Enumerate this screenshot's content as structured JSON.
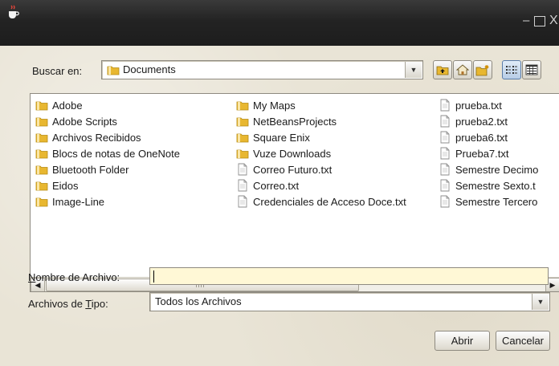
{
  "window": {
    "icon": "java-coffee-icon",
    "controls": {
      "minimize": "–",
      "close": "X"
    }
  },
  "lookin": {
    "label": "Buscar en:",
    "value": "Documents"
  },
  "toolbar": {
    "icons": [
      "up-folder-icon",
      "home-icon",
      "new-folder-icon",
      "list-view-icon",
      "details-view-icon"
    ]
  },
  "files": {
    "columns": [
      [
        {
          "name": "Adobe",
          "type": "folder"
        },
        {
          "name": "Adobe Scripts",
          "type": "folder"
        },
        {
          "name": "Archivos Recibidos",
          "type": "folder"
        },
        {
          "name": "Blocs de notas de OneNote",
          "type": "folder"
        },
        {
          "name": "Bluetooth Folder",
          "type": "folder"
        },
        {
          "name": "Eidos",
          "type": "folder"
        },
        {
          "name": "Image-Line",
          "type": "folder"
        }
      ],
      [
        {
          "name": "My Maps",
          "type": "folder"
        },
        {
          "name": "NetBeansProjects",
          "type": "folder"
        },
        {
          "name": "Square Enix",
          "type": "folder"
        },
        {
          "name": "Vuze Downloads",
          "type": "folder"
        },
        {
          "name": "Correo Futuro.txt",
          "type": "file"
        },
        {
          "name": "Correo.txt",
          "type": "file"
        },
        {
          "name": "Credenciales de Acceso Doce.txt",
          "type": "file"
        }
      ],
      [
        {
          "name": "prueba.txt",
          "type": "file"
        },
        {
          "name": "prueba2.txt",
          "type": "file"
        },
        {
          "name": "prueba6.txt",
          "type": "file"
        },
        {
          "name": "Prueba7.txt",
          "type": "file"
        },
        {
          "name": "Semestre Decimo",
          "type": "file"
        },
        {
          "name": "Semestre Sexto.t",
          "type": "file"
        },
        {
          "name": "Semestre Tercero",
          "type": "file"
        }
      ]
    ]
  },
  "filename": {
    "label_mnemonic": "N",
    "label_rest": "ombre de Archivo:",
    "value": ""
  },
  "filetype": {
    "label_pre": "Archivos de ",
    "label_mnemonic": "T",
    "label_post": "ipo:",
    "value": "Todos los Archivos"
  },
  "buttons": {
    "open": "Abrir",
    "cancel": "Cancelar"
  },
  "colors": {
    "titlebar": "#232323",
    "input_highlight": "#fff8d6",
    "folder": "#e8b730"
  }
}
